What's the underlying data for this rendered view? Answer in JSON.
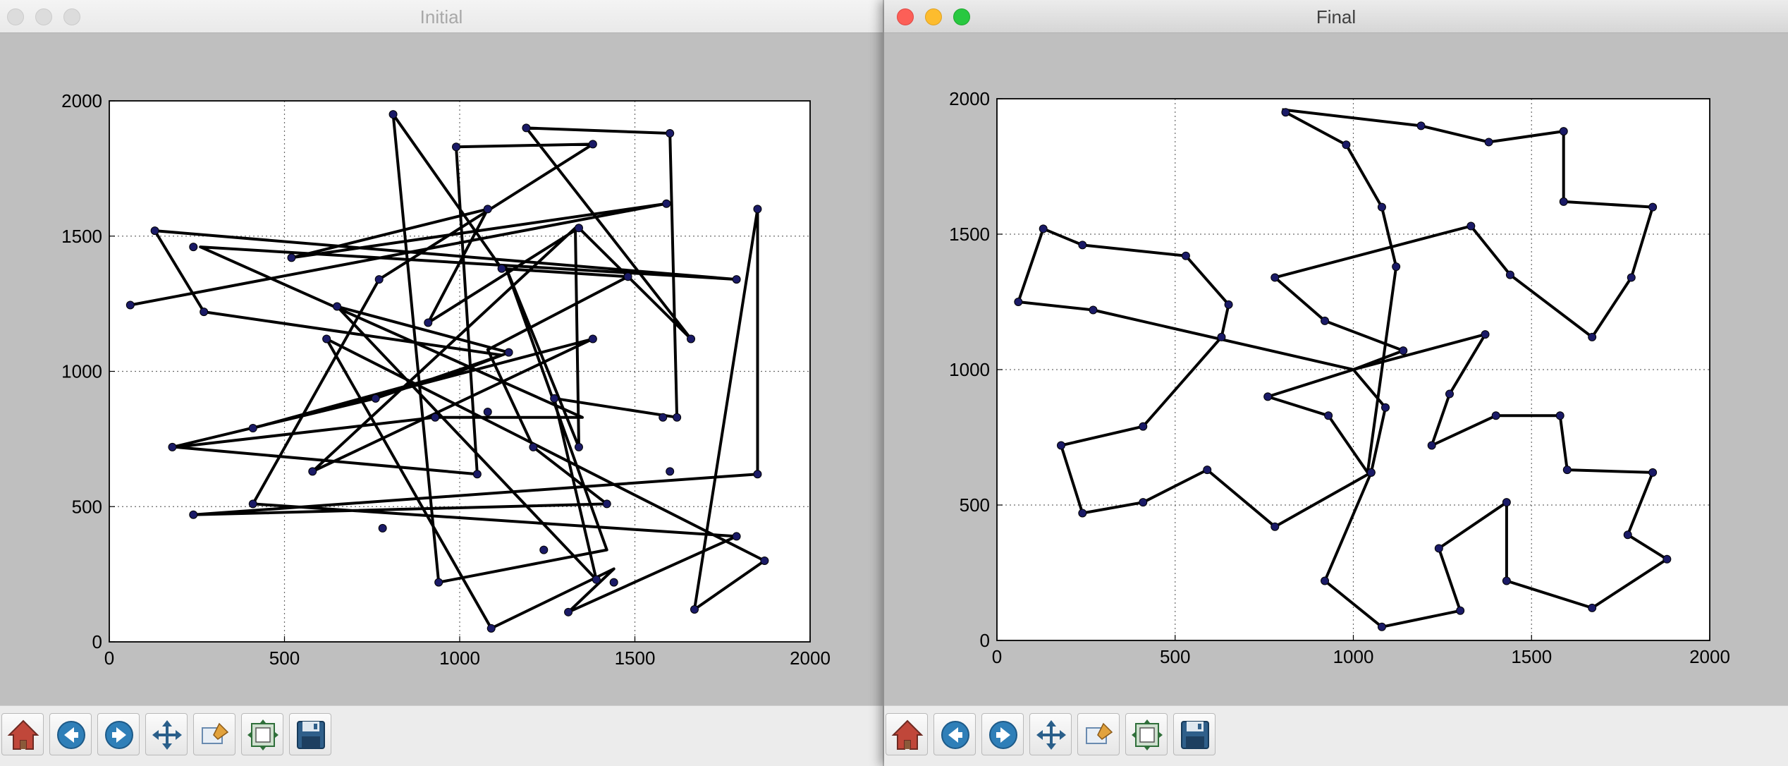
{
  "windows": [
    {
      "title": "Initial",
      "active": false,
      "chart_data": {
        "type": "line",
        "xlim": [
          0,
          2000
        ],
        "ylim": [
          0,
          2000
        ],
        "xticks": [
          "0",
          "500",
          "1000",
          "1500",
          "2000"
        ],
        "yticks": [
          "0",
          "500",
          "1000",
          "1500",
          "2000"
        ],
        "grid": true,
        "points": [
          [
            60,
            1245
          ],
          [
            1590,
            1620
          ],
          [
            520,
            1420
          ],
          [
            1080,
            1600
          ],
          [
            910,
            1180
          ],
          [
            1340,
            1530
          ],
          [
            1660,
            1120
          ],
          [
            1190,
            1900
          ],
          [
            1600,
            1880
          ],
          [
            1620,
            830
          ],
          [
            1270,
            900
          ],
          [
            1390,
            230
          ],
          [
            650,
            1240
          ],
          [
            1140,
            1070
          ],
          [
            1000,
            1000
          ],
          [
            410,
            790
          ],
          [
            1380,
            1120
          ],
          [
            580,
            630
          ],
          [
            1330,
            1530
          ],
          [
            1340,
            720
          ],
          [
            1130,
            1390
          ],
          [
            1420,
            340
          ],
          [
            940,
            220
          ],
          [
            810,
            1950
          ],
          [
            1120,
            1380
          ],
          [
            1480,
            1350
          ],
          [
            1080,
            1080
          ],
          [
            1210,
            720
          ],
          [
            1420,
            510
          ],
          [
            240,
            470
          ],
          [
            1850,
            620
          ],
          [
            1850,
            1600
          ],
          [
            1670,
            120
          ],
          [
            1870,
            300
          ],
          [
            620,
            1120
          ],
          [
            1090,
            50
          ],
          [
            1440,
            270
          ],
          [
            1310,
            110
          ],
          [
            1790,
            390
          ],
          [
            410,
            510
          ],
          [
            770,
            1340
          ],
          [
            1380,
            1840
          ],
          [
            990,
            1830
          ],
          [
            1050,
            620
          ],
          [
            190,
            720
          ],
          [
            930,
            830
          ],
          [
            1350,
            830
          ],
          [
            260,
            1460
          ],
          [
            1790,
            1340
          ],
          [
            130,
            1520
          ],
          [
            270,
            1220
          ],
          [
            1120,
            1060
          ],
          [
            760,
            900
          ],
          [
            180,
            720
          ]
        ],
        "markers": [
          [
            60,
            1245
          ],
          [
            130,
            1520
          ],
          [
            240,
            1460
          ],
          [
            1790,
            1340
          ],
          [
            270,
            1220
          ],
          [
            1380,
            1120
          ],
          [
            1080,
            1600
          ],
          [
            1590,
            1620
          ],
          [
            520,
            1420
          ],
          [
            1340,
            1530
          ],
          [
            1660,
            1120
          ],
          [
            1190,
            1900
          ],
          [
            1600,
            1880
          ],
          [
            1620,
            830
          ],
          [
            1600,
            630
          ],
          [
            1850,
            620
          ],
          [
            1850,
            1600
          ],
          [
            1670,
            120
          ],
          [
            1870,
            300
          ],
          [
            1790,
            390
          ],
          [
            1420,
            510
          ],
          [
            1480,
            1350
          ],
          [
            1270,
            900
          ],
          [
            1390,
            230
          ],
          [
            1440,
            220
          ],
          [
            1310,
            110
          ],
          [
            1240,
            340
          ],
          [
            940,
            220
          ],
          [
            1090,
            50
          ],
          [
            620,
            1120
          ],
          [
            650,
            1240
          ],
          [
            1140,
            1070
          ],
          [
            410,
            790
          ],
          [
            770,
            1340
          ],
          [
            910,
            1180
          ],
          [
            810,
            1950
          ],
          [
            990,
            1830
          ],
          [
            1380,
            1840
          ],
          [
            1050,
            620
          ],
          [
            930,
            830
          ],
          [
            1580,
            830
          ],
          [
            1340,
            720
          ],
          [
            1120,
            1380
          ],
          [
            1080,
            850
          ],
          [
            1210,
            720
          ],
          [
            760,
            900
          ],
          [
            580,
            630
          ],
          [
            780,
            420
          ],
          [
            410,
            510
          ],
          [
            240,
            470
          ],
          [
            180,
            720
          ]
        ]
      }
    },
    {
      "title": "Final",
      "active": true,
      "chart_data": {
        "type": "line",
        "xlim": [
          0,
          2000
        ],
        "ylim": [
          0,
          2000
        ],
        "xticks": [
          "0",
          "500",
          "1000",
          "1500",
          "2000"
        ],
        "yticks": [
          "0",
          "500",
          "1000",
          "1500",
          "2000"
        ],
        "grid": true,
        "points": [
          [
            800,
            1960
          ],
          [
            1190,
            1900
          ],
          [
            1380,
            1840
          ],
          [
            1590,
            1880
          ],
          [
            1590,
            1620
          ],
          [
            1840,
            1600
          ],
          [
            1780,
            1340
          ],
          [
            1670,
            1120
          ],
          [
            1440,
            1350
          ],
          [
            1330,
            1530
          ],
          [
            780,
            1340
          ],
          [
            920,
            1180
          ],
          [
            1140,
            1070
          ],
          [
            1000,
            1000
          ],
          [
            270,
            1220
          ],
          [
            60,
            1250
          ],
          [
            130,
            1520
          ],
          [
            240,
            1460
          ],
          [
            530,
            1420
          ],
          [
            650,
            1240
          ],
          [
            630,
            1120
          ],
          [
            410,
            790
          ],
          [
            180,
            720
          ],
          [
            240,
            470
          ],
          [
            410,
            510
          ],
          [
            590,
            630
          ],
          [
            780,
            420
          ],
          [
            1050,
            620
          ],
          [
            1090,
            860
          ],
          [
            1000,
            1000
          ],
          [
            760,
            900
          ],
          [
            930,
            830
          ],
          [
            1040,
            620
          ],
          [
            1120,
            1380
          ],
          [
            1080,
            1600
          ],
          [
            980,
            1830
          ],
          [
            810,
            1950
          ]
        ],
        "markers": [
          [
            810,
            1950
          ],
          [
            1190,
            1900
          ],
          [
            1380,
            1840
          ],
          [
            1590,
            1880
          ],
          [
            1590,
            1620
          ],
          [
            1840,
            1600
          ],
          [
            1780,
            1340
          ],
          [
            1670,
            1120
          ],
          [
            1440,
            1350
          ],
          [
            1330,
            1530
          ],
          [
            780,
            1340
          ],
          [
            920,
            1180
          ],
          [
            1140,
            1070
          ],
          [
            270,
            1220
          ],
          [
            60,
            1250
          ],
          [
            130,
            1520
          ],
          [
            240,
            1460
          ],
          [
            530,
            1420
          ],
          [
            650,
            1240
          ],
          [
            630,
            1120
          ],
          [
            410,
            790
          ],
          [
            180,
            720
          ],
          [
            240,
            470
          ],
          [
            410,
            510
          ],
          [
            590,
            630
          ],
          [
            780,
            420
          ],
          [
            1050,
            620
          ],
          [
            1090,
            860
          ],
          [
            760,
            900
          ],
          [
            930,
            830
          ],
          [
            1120,
            1380
          ],
          [
            1080,
            1600
          ],
          [
            980,
            1830
          ],
          [
            1370,
            1130
          ],
          [
            1270,
            910
          ],
          [
            1220,
            720
          ],
          [
            1400,
            830
          ],
          [
            1580,
            830
          ],
          [
            1600,
            630
          ],
          [
            1840,
            620
          ],
          [
            1770,
            390
          ],
          [
            1880,
            300
          ],
          [
            1670,
            120
          ],
          [
            1430,
            220
          ],
          [
            1430,
            510
          ],
          [
            1240,
            340
          ],
          [
            1300,
            110
          ],
          [
            1080,
            50
          ],
          [
            920,
            220
          ],
          [
            1050,
            620
          ]
        ],
        "extra_paths": [
          [
            [
              1370,
              1130
            ],
            [
              1270,
              910
            ],
            [
              1220,
              720
            ],
            [
              1400,
              830
            ],
            [
              1580,
              830
            ],
            [
              1600,
              630
            ],
            [
              1840,
              620
            ],
            [
              1770,
              390
            ],
            [
              1880,
              300
            ],
            [
              1670,
              120
            ],
            [
              1430,
              220
            ],
            [
              1430,
              510
            ],
            [
              1240,
              340
            ],
            [
              1300,
              110
            ],
            [
              1080,
              50
            ],
            [
              920,
              220
            ],
            [
              1050,
              620
            ]
          ],
          [
            [
              1370,
              1130
            ],
            [
              1000,
              1000
            ]
          ]
        ]
      }
    }
  ],
  "toolbar": {
    "buttons": [
      {
        "name": "home-button",
        "icon": "home-icon"
      },
      {
        "name": "back-button",
        "icon": "back-arrow-icon"
      },
      {
        "name": "forward-button",
        "icon": "forward-arrow-icon"
      },
      {
        "name": "pan-button",
        "icon": "move-arrows-icon"
      },
      {
        "name": "zoom-button",
        "icon": "zoom-rect-icon"
      },
      {
        "name": "subplots-button",
        "icon": "subplots-icon"
      },
      {
        "name": "save-button",
        "icon": "save-disk-icon"
      }
    ]
  }
}
